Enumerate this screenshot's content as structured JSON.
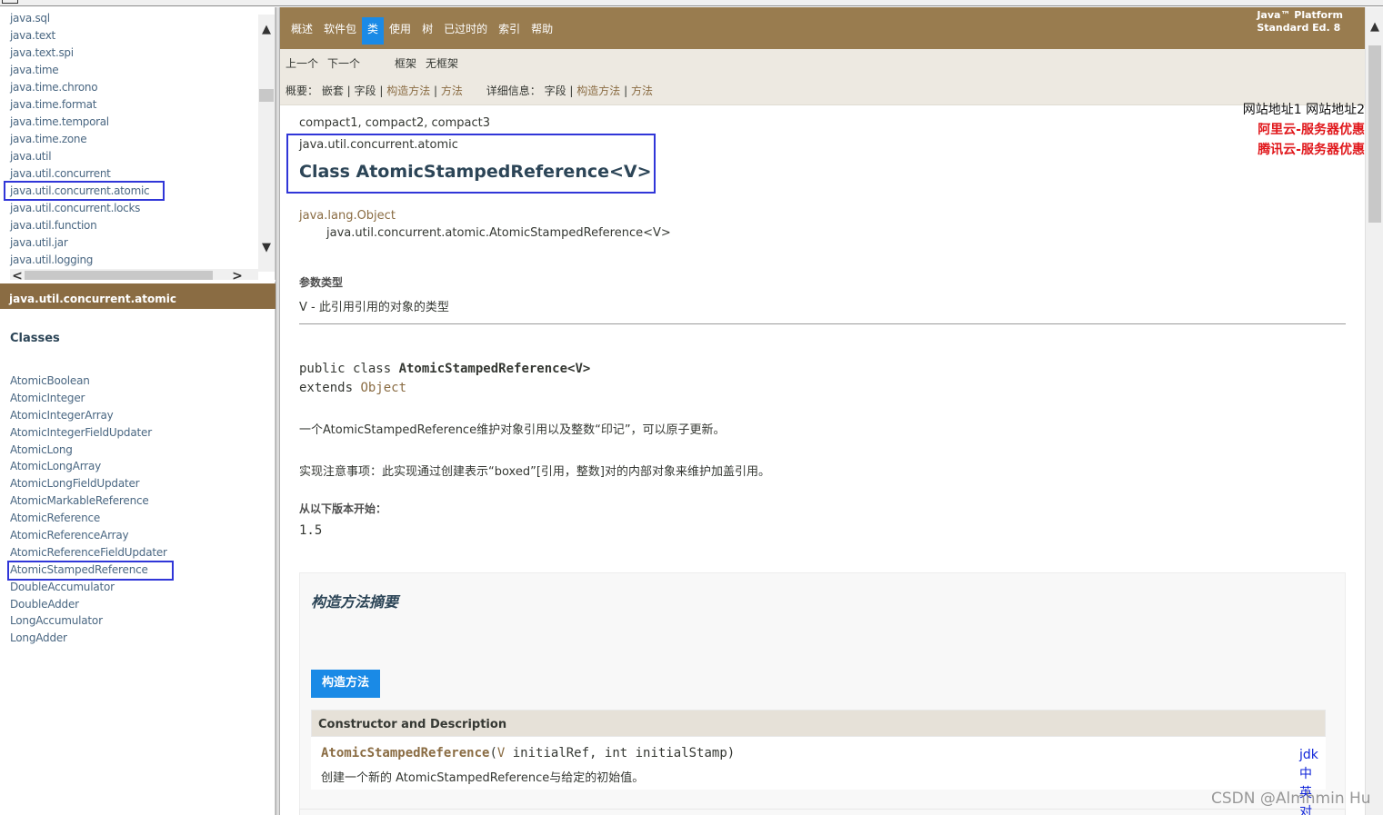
{
  "package_list": [
    "java.sql",
    "java.text",
    "java.text.spi",
    "java.time",
    "java.time.chrono",
    "java.time.format",
    "java.time.temporal",
    "java.time.zone",
    "java.util",
    "java.util.concurrent",
    "java.util.concurrent.atomic",
    "java.util.concurrent.locks",
    "java.util.function",
    "java.util.jar",
    "java.util.logging"
  ],
  "package_frame": {
    "title": "java.util.concurrent.atomic",
    "classes_heading": "Classes",
    "classes": [
      "AtomicBoolean",
      "AtomicInteger",
      "AtomicIntegerArray",
      "AtomicIntegerFieldUpdater",
      "AtomicLong",
      "AtomicLongArray",
      "AtomicLongFieldUpdater",
      "AtomicMarkableReference",
      "AtomicReference",
      "AtomicReferenceArray",
      "AtomicReferenceFieldUpdater",
      "AtomicStampedReference",
      "DoubleAccumulator",
      "DoubleAdder",
      "LongAccumulator",
      "LongAdder"
    ]
  },
  "top_nav": {
    "links": [
      "概述",
      "软件包",
      "类",
      "使用",
      "树",
      "已过时的",
      "索引",
      "帮助"
    ],
    "active": "类",
    "brand_line1": "Java™ Platform",
    "brand_line2": "Standard Ed. 8"
  },
  "sub_nav": {
    "prev": "上一个",
    "next": "下一个",
    "frames": "框架",
    "no_frames": "无框架",
    "summary_label": "概要：",
    "summary_nested": "嵌套",
    "summary_field": "字段",
    "summary_constructor": "构造方法",
    "summary_method": "方法",
    "detail_label": "详细信息：",
    "detail_field": "字段",
    "detail_constructor": "构造方法",
    "detail_method": "方法",
    "sep": " | "
  },
  "ad": {
    "site_links": "网站地址1 网站地址2",
    "aliyun": "阿里云-服务器优惠",
    "tencent": "腾讯云-服务器优惠"
  },
  "content": {
    "profiles": "compact1, compact2, compact3",
    "package": "java.util.concurrent.atomic",
    "class_title": "Class AtomicStampedReference<V>",
    "inherit_parent": "java.lang.Object",
    "inherit_child": "java.util.concurrent.atomic.AtomicStampedReference<V>",
    "type_params_heading": "参数类型",
    "type_param": "V - 此引用引用的对象的类型",
    "sig_public_class": "public class ",
    "sig_name": "AtomicStampedReference<V>",
    "sig_extends": "extends ",
    "sig_parent": "Object",
    "description": "一个AtomicStampedReference维护对象引用以及整数“印记”，可以原子更新。",
    "impl_note": "实现注意事项：此实现通过创建表示“boxed”[引用，整数]对的内部对象来维护加盖引用。",
    "since_heading": "从以下版本开始：",
    "since_value": "1.5"
  },
  "constructor_summary": {
    "heading": "构造方法摘要",
    "tab": "构造方法",
    "column": "Constructor and Description",
    "row_name": "AtomicStampedReference",
    "row_open": "(",
    "row_type": "V",
    "row_rest": " initialRef, int initialStamp)",
    "row_desc": "创建一个新的 AtomicStampedReference与给定的初始值。"
  },
  "side_tab": [
    "jdk",
    "中",
    "英",
    "对"
  ],
  "watermark": "CSDN @Almhmin Hu",
  "icons": {
    "scroll_up": "▲",
    "scroll_down": "▼",
    "scroll_left": "<",
    "scroll_right": ">"
  }
}
